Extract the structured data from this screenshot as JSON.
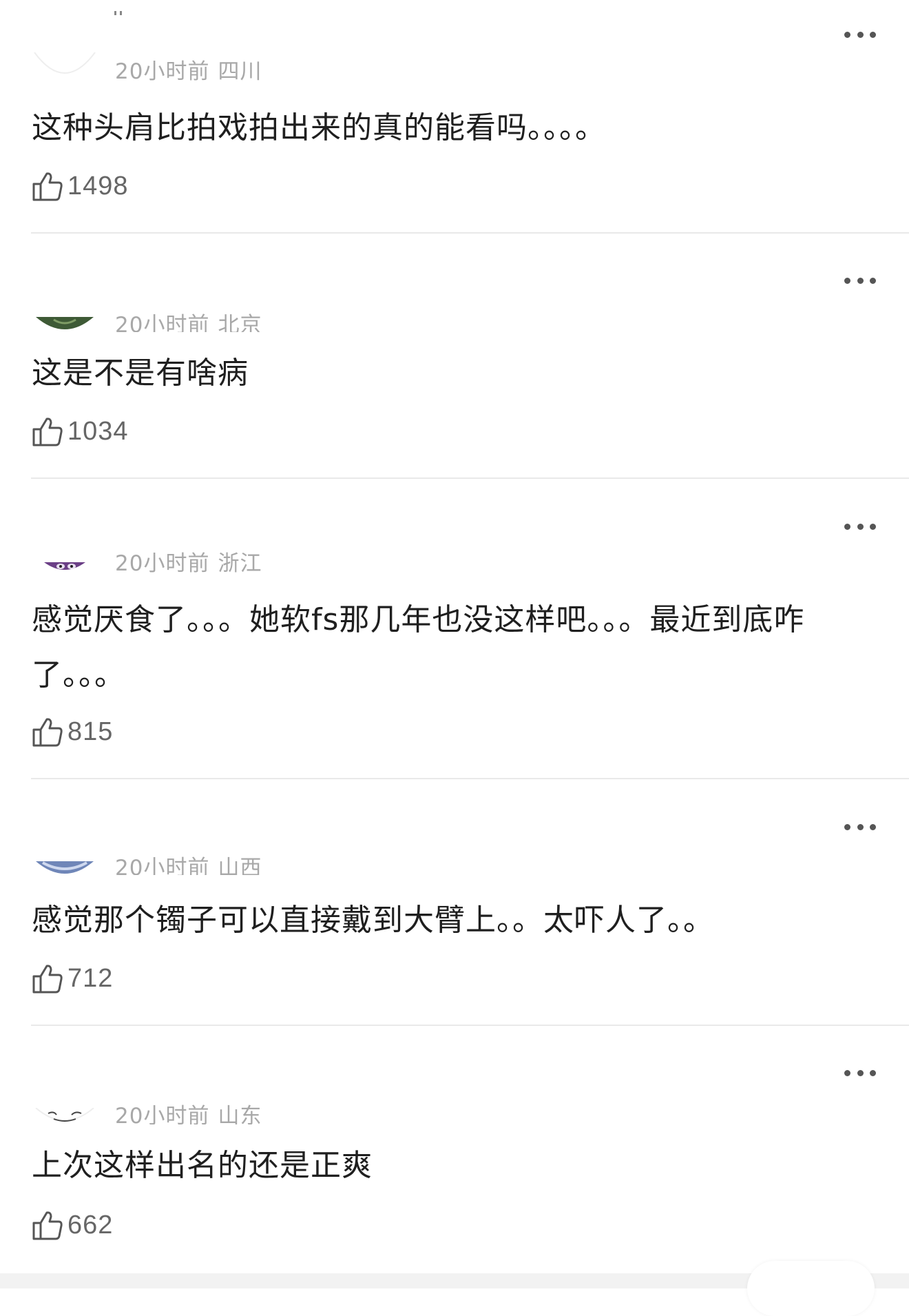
{
  "comments": [
    {
      "time": "20小时前",
      "location": "四川",
      "text": "这种头肩比拍戏拍出来的真的能看吗。。。。",
      "likes": "1498"
    },
    {
      "time": "20小时前",
      "location": "北京",
      "text": "这是不是有啥病",
      "likes": "1034"
    },
    {
      "time": "20小时前",
      "location": "浙江",
      "text": "感觉厌食了。。。她软fs那几年也没这样吧。。。最近到底咋了。。。",
      "likes": "815"
    },
    {
      "time": "20小时前",
      "location": "山西",
      "text": "感觉那个镯子可以直接戴到大臂上。。太吓人了。。",
      "likes": "712"
    },
    {
      "time": "20小时前",
      "location": "山东",
      "text": "上次这样出名的还是正爽",
      "likes": "662"
    }
  ],
  "icons": {
    "like": "thumbs-up-outline-icon",
    "more": "more-dots-icon"
  },
  "colors": {
    "meta": "#a8a8a8",
    "text": "#1f1f1f",
    "count": "#666666",
    "divider": "#e9e9e9"
  }
}
